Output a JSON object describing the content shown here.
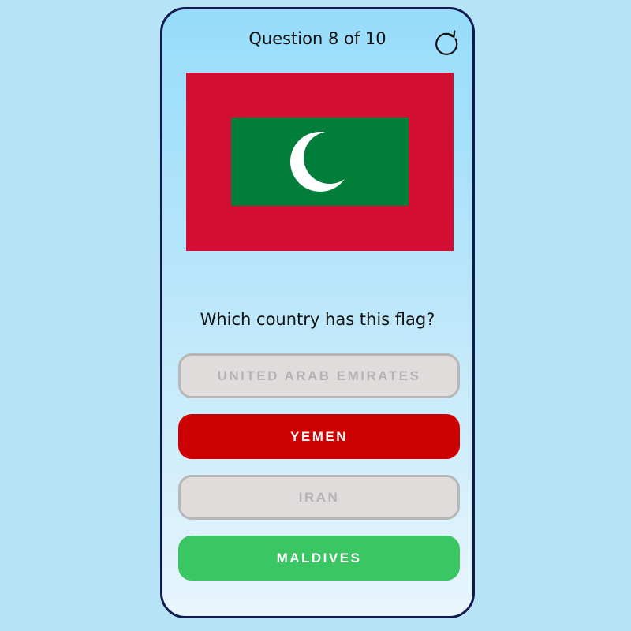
{
  "header": {
    "question_counter": "Question 8 of 10",
    "restart_icon": "restart-icon"
  },
  "flag": {
    "country_shown": "Maldives",
    "colors": {
      "field": "#d20f33",
      "panel": "#007e3a",
      "crescent": "#ffffff"
    }
  },
  "question": {
    "prompt": "Which country has this flag?"
  },
  "answers": [
    {
      "label": "UNITED ARAB EMIRATES",
      "state": "disabled"
    },
    {
      "label": "YEMEN",
      "state": "selected-wrong"
    },
    {
      "label": "IRAN",
      "state": "disabled"
    },
    {
      "label": "MALDIVES",
      "state": "correct"
    }
  ],
  "colors": {
    "page_background": "#b7e3f7",
    "card_border": "#0f1b4e",
    "wrong": "#cc0000",
    "correct": "#3ac662",
    "disabled": "#e0dcdc"
  }
}
